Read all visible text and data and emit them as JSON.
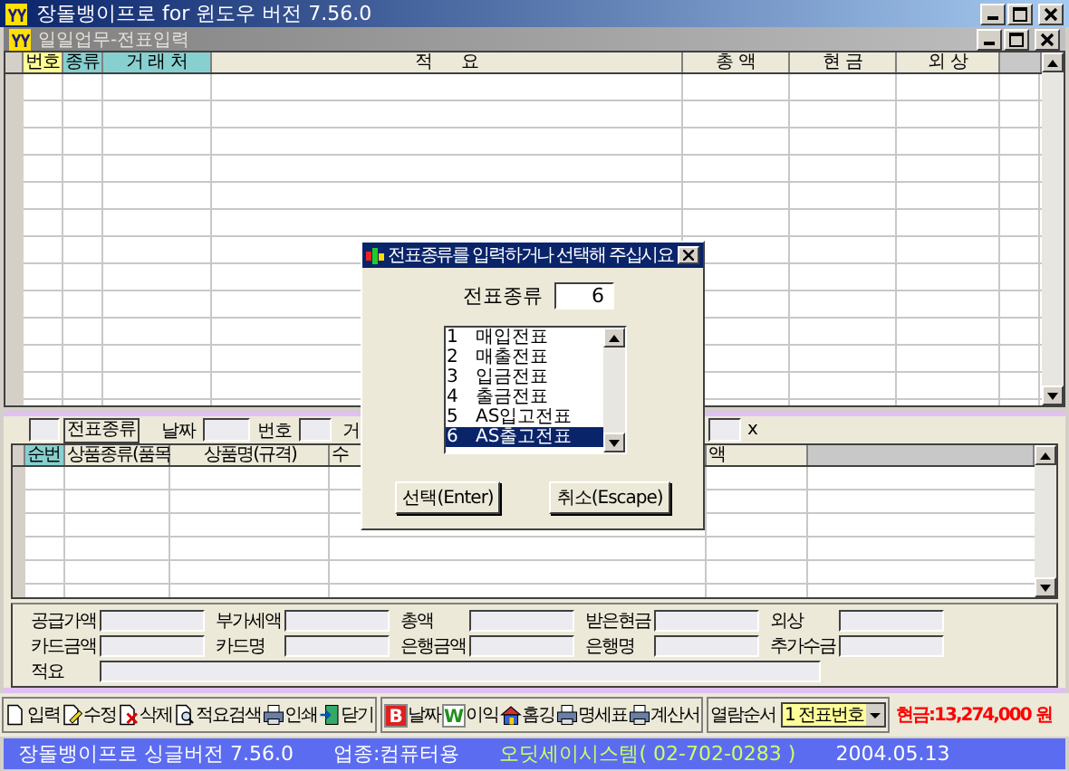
{
  "app_title": "장돌뱅이프로 for 윈도우 버전 7.56.0",
  "child_title": "일일업무-전표입력",
  "main_table": {
    "columns": [
      {
        "label": "번호",
        "color": "#ffff99"
      },
      {
        "label": "종류",
        "color": "#88d0d0"
      },
      {
        "label": "거 래 처",
        "color": "#88d0d0"
      },
      {
        "label": "적      요",
        "color": "#ece9d8"
      },
      {
        "label": "총 액",
        "color": "#ece9d8"
      },
      {
        "label": "현 금",
        "color": "#ece9d8"
      },
      {
        "label": "외 상",
        "color": "#ece9d8"
      }
    ]
  },
  "entry_bar": {
    "type_label": "전표종류",
    "date_label": "날짜",
    "number_label": "번호",
    "partner_label": "거",
    "tail_label": "x"
  },
  "detail_table": {
    "columns": [
      {
        "label": "순번",
        "color": "#88d0d0"
      },
      {
        "label": "상품종류(품목",
        "color": "#ece9d8"
      },
      {
        "label": "상품명(규격)",
        "color": "#ece9d8"
      },
      {
        "label": "수",
        "color": "#ece9d8"
      },
      {
        "label": "액",
        "color": "#ece9d8"
      }
    ]
  },
  "totals": [
    {
      "label": "공급가액"
    },
    {
      "label": "부가세액"
    },
    {
      "label": "총액"
    },
    {
      "label": "받은현금"
    },
    {
      "label": "외상"
    },
    {
      "label": "카드금액"
    },
    {
      "label": "카드명"
    },
    {
      "label": "은행금액"
    },
    {
      "label": "은행명"
    },
    {
      "label": "추가수금"
    }
  ],
  "memo_label": "적요",
  "toolbar": [
    {
      "kind": "page",
      "label": "입력"
    },
    {
      "kind": "edit",
      "label": "수정"
    },
    {
      "kind": "delete",
      "label": "삭제"
    },
    {
      "kind": "search",
      "label": "적요검색"
    },
    {
      "kind": "printer",
      "label": "인쇄"
    },
    {
      "kind": "door",
      "label": "닫기"
    }
  ],
  "toolbar2": [
    {
      "kind": "letter",
      "glyph": "B",
      "color": "#e02020",
      "label": "날짜"
    },
    {
      "kind": "letter",
      "glyph": "W",
      "color": "#209020",
      "label": "이익"
    },
    {
      "kind": "house",
      "label": "홈깅"
    },
    {
      "kind": "printer",
      "label": "명세표"
    },
    {
      "kind": "printer",
      "label": "계산서"
    }
  ],
  "sort": {
    "label": "열람순서",
    "value": "1 전표번호"
  },
  "cash": "현금:13,274,000 원",
  "status": [
    {
      "text": "장돌뱅이프로 싱글버전 7.56.0",
      "color": "#ffffff"
    },
    {
      "text": "업종:컴퓨터용",
      "color": "#ffffff"
    },
    {
      "text": "오딧세이시스템( 02-702-0283 )",
      "color": "#ccff66"
    },
    {
      "text": "2004.05.13",
      "color": "#ffffff"
    }
  ],
  "dialog": {
    "title": "전표종류를 입력하거나 선택해 주십시요",
    "field_label": "전표종류",
    "field_value": "6",
    "items": [
      {
        "number": "1",
        "label": "매입전표",
        "selected": false
      },
      {
        "number": "2",
        "label": "매출전표",
        "selected": false
      },
      {
        "number": "3",
        "label": "입금전표",
        "selected": false
      },
      {
        "number": "4",
        "label": "출금전표",
        "selected": false
      },
      {
        "number": "5",
        "label": "AS입고전표",
        "selected": false
      },
      {
        "number": "6",
        "label": "AS출고전표",
        "selected": true
      }
    ],
    "buttons": [
      "선택(Enter)",
      "취소(Escape)"
    ]
  }
}
